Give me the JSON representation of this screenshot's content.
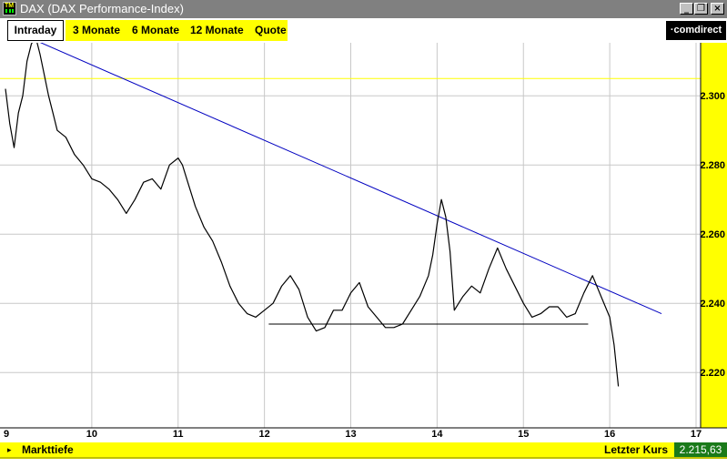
{
  "window": {
    "title": "DAX (DAX Performance-Index)",
    "app_icon_text": "TM",
    "controls": {
      "minimize": "_",
      "restore": "❐",
      "close": "×"
    }
  },
  "toolbar": {
    "tabs": [
      "Intraday",
      "3 Monate",
      "6 Monate",
      "12 Monate",
      "Quote"
    ],
    "active_tab": "Intraday",
    "brand": "·comdirect"
  },
  "chart_data": {
    "type": "line",
    "title": "",
    "xlabel": "",
    "ylabel": "",
    "x_ticks": [
      "9",
      "10",
      "11",
      "12",
      "13",
      "14",
      "15",
      "16",
      "17"
    ],
    "y_ticks": [
      "2.300",
      "2.280",
      "2.260",
      "2.240",
      "2.220"
    ],
    "xlim": [
      9,
      17
    ],
    "ylim": [
      2204,
      2314
    ],
    "grid": true,
    "reference_line": {
      "value": 2305,
      "color": "#ffff00"
    },
    "trend_lines": [
      {
        "from": [
          9.35,
          2316
        ],
        "to": [
          16.6,
          2237
        ],
        "color": "#0000c0"
      },
      {
        "from": [
          12.05,
          2234
        ],
        "to": [
          15.75,
          2234
        ],
        "color": "#000000"
      }
    ],
    "series": [
      {
        "color": "#000000",
        "x": [
          9.0,
          9.05,
          9.1,
          9.15,
          9.2,
          9.25,
          9.3,
          9.35,
          9.4,
          9.45,
          9.5,
          9.55,
          9.6,
          9.7,
          9.8,
          9.9,
          10.0,
          10.1,
          10.2,
          10.3,
          10.4,
          10.5,
          10.6,
          10.7,
          10.8,
          10.9,
          11.0,
          11.05,
          11.1,
          11.2,
          11.3,
          11.4,
          11.5,
          11.6,
          11.7,
          11.8,
          11.9,
          12.0,
          12.1,
          12.2,
          12.3,
          12.4,
          12.5,
          12.6,
          12.7,
          12.8,
          12.9,
          13.0,
          13.1,
          13.2,
          13.3,
          13.4,
          13.5,
          13.6,
          13.7,
          13.8,
          13.9,
          13.95,
          14.0,
          14.05,
          14.1,
          14.15,
          14.2,
          14.3,
          14.4,
          14.5,
          14.6,
          14.7,
          14.8,
          14.9,
          15.0,
          15.1,
          15.2,
          15.3,
          15.4,
          15.5,
          15.6,
          15.7,
          15.8,
          15.9,
          16.0,
          16.05,
          16.1
        ],
        "values": [
          2302,
          2292,
          2285,
          2295,
          2300,
          2310,
          2315,
          2317,
          2312,
          2306,
          2300,
          2295,
          2290,
          2288,
          2283,
          2280,
          2276,
          2275,
          2273,
          2270,
          2266,
          2270,
          2275,
          2276,
          2273,
          2280,
          2282,
          2280,
          2276,
          2268,
          2262,
          2258,
          2252,
          2245,
          2240,
          2237,
          2236,
          2238,
          2240,
          2245,
          2248,
          2244,
          2236,
          2232,
          2233,
          2238,
          2238,
          2243,
          2246,
          2239,
          2236,
          2233,
          2233,
          2234,
          2238,
          2242,
          2248,
          2254,
          2263,
          2270,
          2265,
          2255,
          2238,
          2242,
          2245,
          2243,
          2250,
          2256,
          2250,
          2245,
          2240,
          2236,
          2237,
          2239,
          2239,
          2236,
          2237,
          2243,
          2248,
          2242,
          2236,
          2228,
          2216
        ]
      }
    ]
  },
  "bottom": {
    "arrow": "▸",
    "label": "Markttiefe",
    "last_label": "Letzter Kurs",
    "last_value": "2.215,63"
  }
}
